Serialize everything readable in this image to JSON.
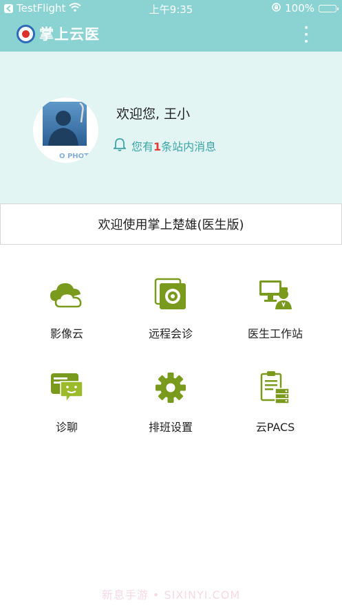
{
  "status_bar": {
    "carrier": "TestFlight",
    "time": "上午9:35",
    "battery_percent": "100%",
    "battery_level": 1.0,
    "icons": [
      "back-arrow-icon",
      "wifi-icon",
      "orientation-lock-icon",
      "battery-icon"
    ]
  },
  "nav": {
    "title": "掌上云医",
    "icons": [
      "hospital-logo-icon",
      "more-vertical-icon"
    ]
  },
  "profile": {
    "greeting": "欢迎您, 王小",
    "avatar_caption": "O PHOT",
    "notice": {
      "prefix": "您有",
      "count": "1",
      "suffix": "条站内消息",
      "icon": "bell-icon"
    }
  },
  "banner": {
    "text": "欢迎使用掌上楚雄(医生版)"
  },
  "menu": {
    "items": [
      {
        "label": "影像云",
        "icon": "cloud-icon"
      },
      {
        "label": "远程会诊",
        "icon": "remote-consult-icon"
      },
      {
        "label": "医生工作站",
        "icon": "doctor-workstation-icon"
      },
      {
        "label": "诊聊",
        "icon": "chat-icon"
      },
      {
        "label": "排班设置",
        "icon": "gear-icon"
      },
      {
        "label": "云PACS",
        "icon": "clipboard-server-icon"
      }
    ]
  },
  "watermark": "新息手游 • SIXINYI.COM",
  "colors": {
    "header": "#8bd3d3",
    "profile_bg": "#e3f5f3",
    "accent": "#3aa3a8",
    "icon_green": "#7a9a1d",
    "alert": "#e53935"
  }
}
